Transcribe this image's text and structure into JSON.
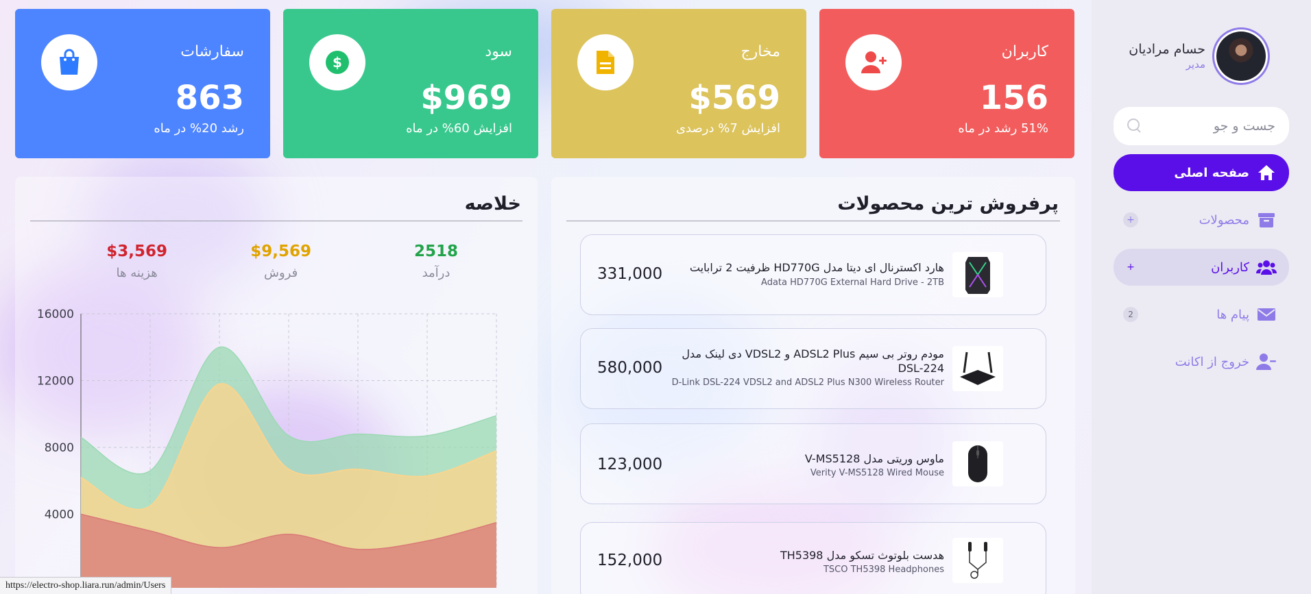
{
  "profile": {
    "name": "حسام مرادیان",
    "role": "مدیر"
  },
  "search": {
    "placeholder": "جست و جو"
  },
  "nav": [
    {
      "label": "صفحه اصلی",
      "icon": "home-icon",
      "state": "active"
    },
    {
      "label": "محصولات",
      "icon": "archive-icon",
      "marker": "+"
    },
    {
      "label": "کاربران",
      "icon": "users-icon",
      "marker": "+",
      "state": "hover"
    },
    {
      "label": "پیام ها",
      "icon": "envelope-icon",
      "badge": "2"
    },
    {
      "label": "خروج از اکانت",
      "icon": "user-minus-icon"
    }
  ],
  "cards": [
    {
      "title": "کاربران",
      "value": "156",
      "sub": "51% رشد در ماه",
      "color": "#f25c5c",
      "icon": "user-plus-icon",
      "icon_color": "#ef4a4a"
    },
    {
      "title": "مخارج",
      "value": "$569",
      "sub": "افزایش 7% درصدی",
      "color": "#dcc35c",
      "icon": "document-icon",
      "icon_color": "#f0b400"
    },
    {
      "title": "سود",
      "value": "$969",
      "sub": "افزایش 60% در ماه",
      "color": "#38c88d",
      "icon": "dollar-icon",
      "icon_color": "#1fbf6e"
    },
    {
      "title": "سفارشات",
      "value": "863",
      "sub": "رشد 20% در ماه",
      "color": "#4d84ff",
      "icon": "shopping-bag-icon",
      "icon_color": "#2f7bff"
    }
  ],
  "bestsellers": {
    "title": "پرفروش ترین محصولات",
    "items": [
      {
        "name": "هارد اکسترنال ای دیتا مدل HD770G ظرفیت 2 ترابایت",
        "name_en": "Adata HD770G External Hard Drive - 2TB",
        "price": "331,000",
        "icon": "hard-drive-icon"
      },
      {
        "name": "مودم روتر بی سیم ADSL2 Plus و VDSL2 دی لینک مدل DSL-224",
        "name_en": "D-Link DSL-224 VDSL2 and ADSL2 Plus N300 Wireless Router",
        "price": "580,000",
        "icon": "router-icon"
      },
      {
        "name": "ماوس وریتی مدل V-MS5128",
        "name_en": "Verity V-MS5128 Wired Mouse",
        "price": "123,000",
        "icon": "mouse-icon"
      },
      {
        "name": "هدست بلوتوث تسکو مدل TH5398",
        "name_en": "TSCO TH5398 Headphones",
        "price": "152,000",
        "icon": "earphones-icon"
      }
    ]
  },
  "summary": {
    "title": "خلاصه",
    "stats": [
      {
        "value": "2518",
        "label": "درآمد",
        "color": "#22a34a"
      },
      {
        "value": "$9,569",
        "label": "فروش",
        "color": "#e0a300"
      },
      {
        "value": "$3,569",
        "label": "هزینه ها",
        "color": "#d0242f"
      }
    ]
  },
  "chart_data": {
    "type": "area",
    "title": "",
    "xlabel": "",
    "ylabel": "",
    "ylim": [
      0,
      16000
    ],
    "yticks": [
      4000,
      8000,
      12000,
      16000
    ],
    "grid": true,
    "x": [
      0,
      1,
      2,
      3,
      4,
      5,
      6
    ],
    "series": [
      {
        "values": [
          8600,
          6600,
          14000,
          8700,
          8800,
          8700,
          9900
        ],
        "color": "#9bd9b3"
      },
      {
        "values": [
          6200,
          4500,
          11800,
          6700,
          6700,
          6300,
          7800
        ],
        "color": "#ffd48a"
      },
      {
        "values": [
          4000,
          3000,
          2000,
          2800,
          1900,
          2400,
          3500
        ],
        "color": "#d97a78"
      }
    ]
  },
  "statusbar": {
    "url": "https://electro-shop.liara.run/admin/Users"
  }
}
